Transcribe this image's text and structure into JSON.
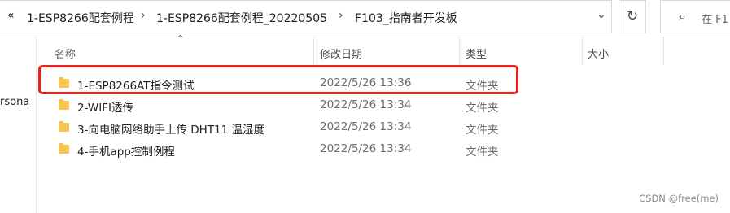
{
  "address_bar": {
    "overflow_glyph": "«",
    "breadcrumbs": [
      "1-ESP8266配套例程",
      "1-ESP8266配套例程_20220505",
      "F103_指南者开发板"
    ],
    "separator_glyph": "›",
    "dropdown_glyph": "⌄"
  },
  "refresh_glyph": "↻",
  "search": {
    "icon_glyph": "⌕",
    "placeholder": "在 F1"
  },
  "nav_pane": {
    "partial_label": "rsona"
  },
  "file_list": {
    "sort_indicator": "^",
    "columns": [
      "名称",
      "修改日期",
      "类型",
      "大小"
    ],
    "rows": [
      {
        "name": "1-ESP8266AT指令测试",
        "modified": "2022/5/26 13:36",
        "type": "文件夹",
        "size": ""
      },
      {
        "name": "2-WIFI透传",
        "modified": "2022/5/26 13:34",
        "type": "文件夹",
        "size": ""
      },
      {
        "name": "3-向电脑网络助手上传 DHT11 温湿度",
        "modified": "2022/5/26 13:34",
        "type": "文件夹",
        "size": ""
      },
      {
        "name": "4-手机app控制例程",
        "modified": "2022/5/26 13:34",
        "type": "文件夹",
        "size": ""
      }
    ],
    "highlight_color": "#e8231f",
    "folder_color": "#f5c64f"
  },
  "watermark": "CSDN @free(me)"
}
